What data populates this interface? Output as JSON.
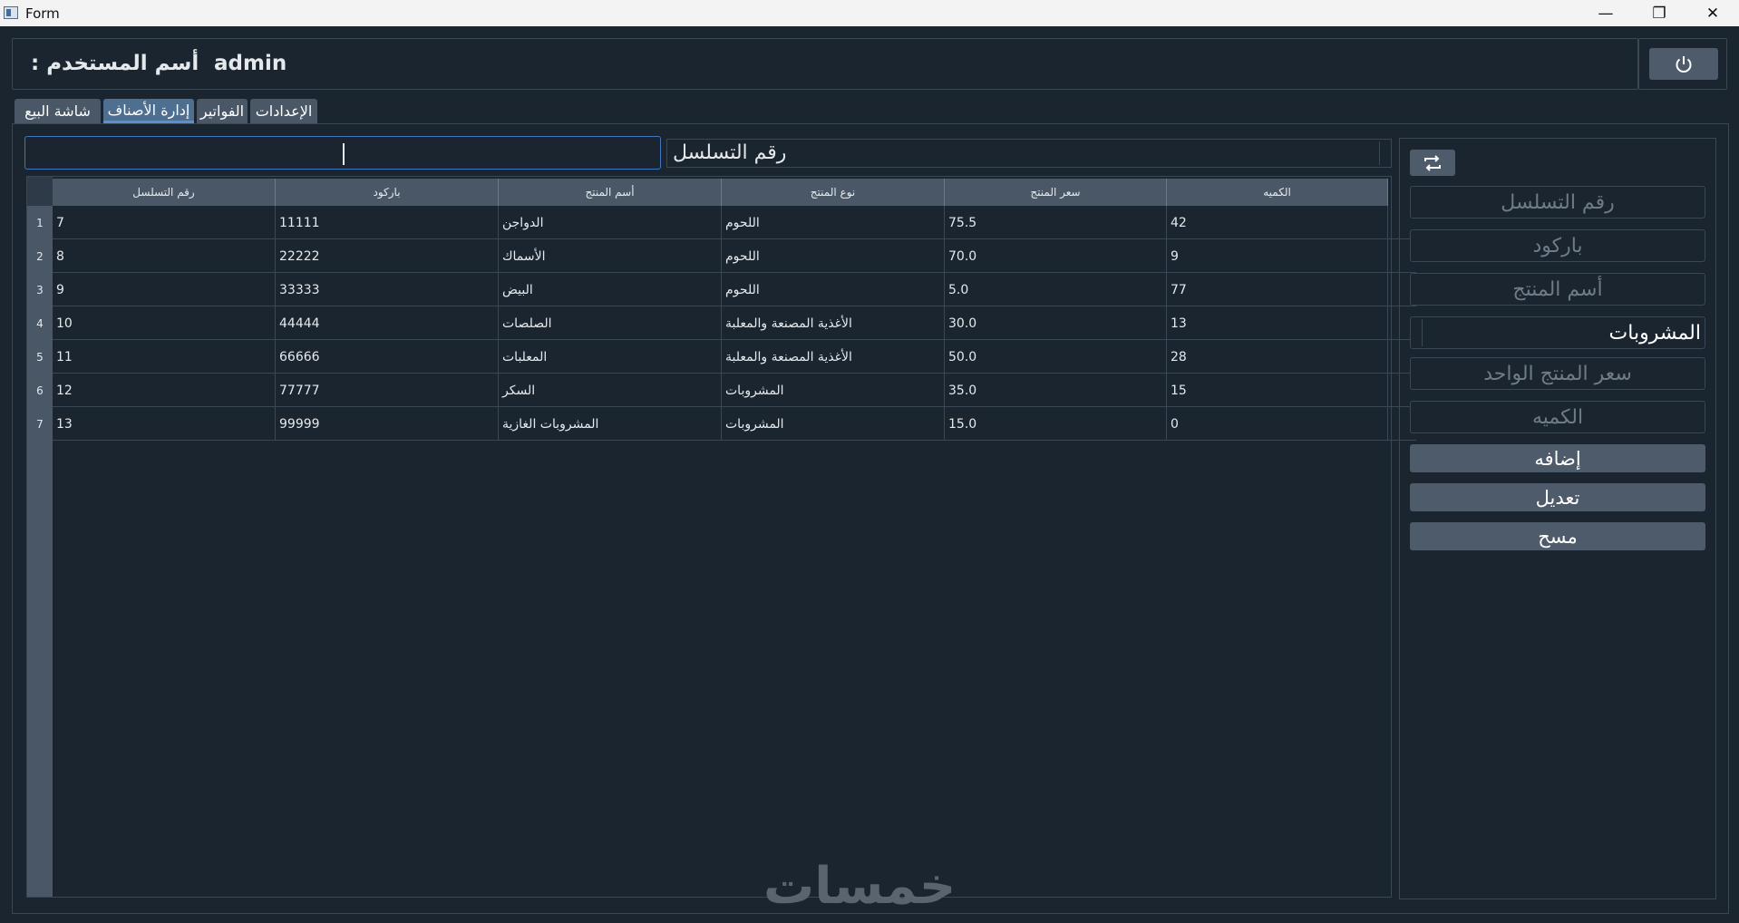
{
  "window": {
    "title": "Form"
  },
  "header": {
    "user_label": "أسم المستخدم :",
    "username": "admin"
  },
  "tabs": [
    {
      "label": "شاشة البيع"
    },
    {
      "label": "إدارة الأصناف"
    },
    {
      "label": "الفواتير"
    },
    {
      "label": "الإعدادات"
    }
  ],
  "search": {
    "value": "",
    "field_selected": "رقم التسلسل"
  },
  "table": {
    "headers": [
      "رقم التسلسل",
      "باركود",
      "أسم المنتج",
      "نوع المنتج",
      "سعر المنتج",
      "الكميه"
    ],
    "rows": [
      {
        "num": "1",
        "cells": [
          "7",
          "11111",
          "الدواجن",
          "اللحوم",
          "75.5",
          "42"
        ]
      },
      {
        "num": "2",
        "cells": [
          "8",
          "22222",
          "الأسماك",
          "اللحوم",
          "70.0",
          "9"
        ]
      },
      {
        "num": "3",
        "cells": [
          "9",
          "33333",
          "البيض",
          "اللحوم",
          "5.0",
          "77"
        ]
      },
      {
        "num": "4",
        "cells": [
          "10",
          "44444",
          "الصلصات",
          "الأغذية المصنعة والمعلبة",
          "30.0",
          "13"
        ]
      },
      {
        "num": "5",
        "cells": [
          "11",
          "66666",
          "المعلبات",
          "الأغذية المصنعة والمعلبة",
          "50.0",
          "28"
        ]
      },
      {
        "num": "6",
        "cells": [
          "12",
          "77777",
          "السكر",
          "المشروبات",
          "35.0",
          "15"
        ]
      },
      {
        "num": "7",
        "cells": [
          "13",
          "99999",
          "المشروبات الغازية",
          "المشروبات",
          "15.0",
          "0"
        ]
      }
    ]
  },
  "form": {
    "serial_placeholder": "رقم التسلسل",
    "barcode_placeholder": "باركود",
    "name_placeholder": "أسم المنتج",
    "type_selected": "المشروبات",
    "price_placeholder": "سعر المنتج الواحد",
    "qty_placeholder": "الكميه",
    "add_label": "إضافه",
    "edit_label": "تعديل",
    "delete_label": "مسح"
  },
  "watermark": "خمسات"
}
